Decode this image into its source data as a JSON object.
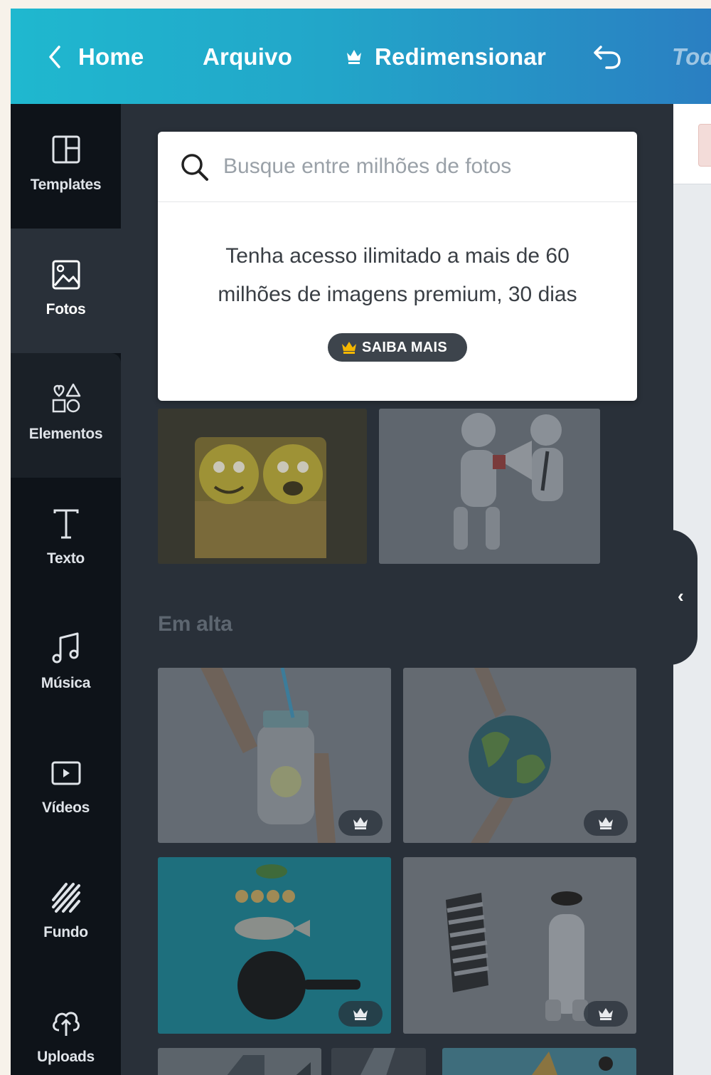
{
  "topbar": {
    "home_label": "Home",
    "arquivo_label": "Arquivo",
    "resize_label": "Redimensionar",
    "todos_label": "Tod"
  },
  "sidebar": {
    "items": [
      {
        "label": "Templates",
        "icon": "templates-icon"
      },
      {
        "label": "Fotos",
        "icon": "photo-icon"
      },
      {
        "label": "Elementos",
        "icon": "elements-icon"
      },
      {
        "label": "Texto",
        "icon": "text-icon"
      },
      {
        "label": "Música",
        "icon": "music-icon"
      },
      {
        "label": "Vídeos",
        "icon": "video-icon"
      },
      {
        "label": "Fundo",
        "icon": "background-icon"
      },
      {
        "label": "Uploads",
        "icon": "upload-icon"
      }
    ],
    "active": "Fotos"
  },
  "search": {
    "placeholder": "Busque entre milhões de fotos"
  },
  "promo": {
    "line1": "Tenha acesso ilimitado a mais de 60",
    "line2": "milhões de imagens premium, 30 dias",
    "button_label": "SAIBA MAIS"
  },
  "sections": {
    "trending_title": "Em alta"
  },
  "colors": {
    "topbar_gradient_start": "#1fb8cf",
    "topbar_gradient_end": "#2a7fc2",
    "panel_bg": "#293039",
    "rail_bg": "#0e1319"
  }
}
